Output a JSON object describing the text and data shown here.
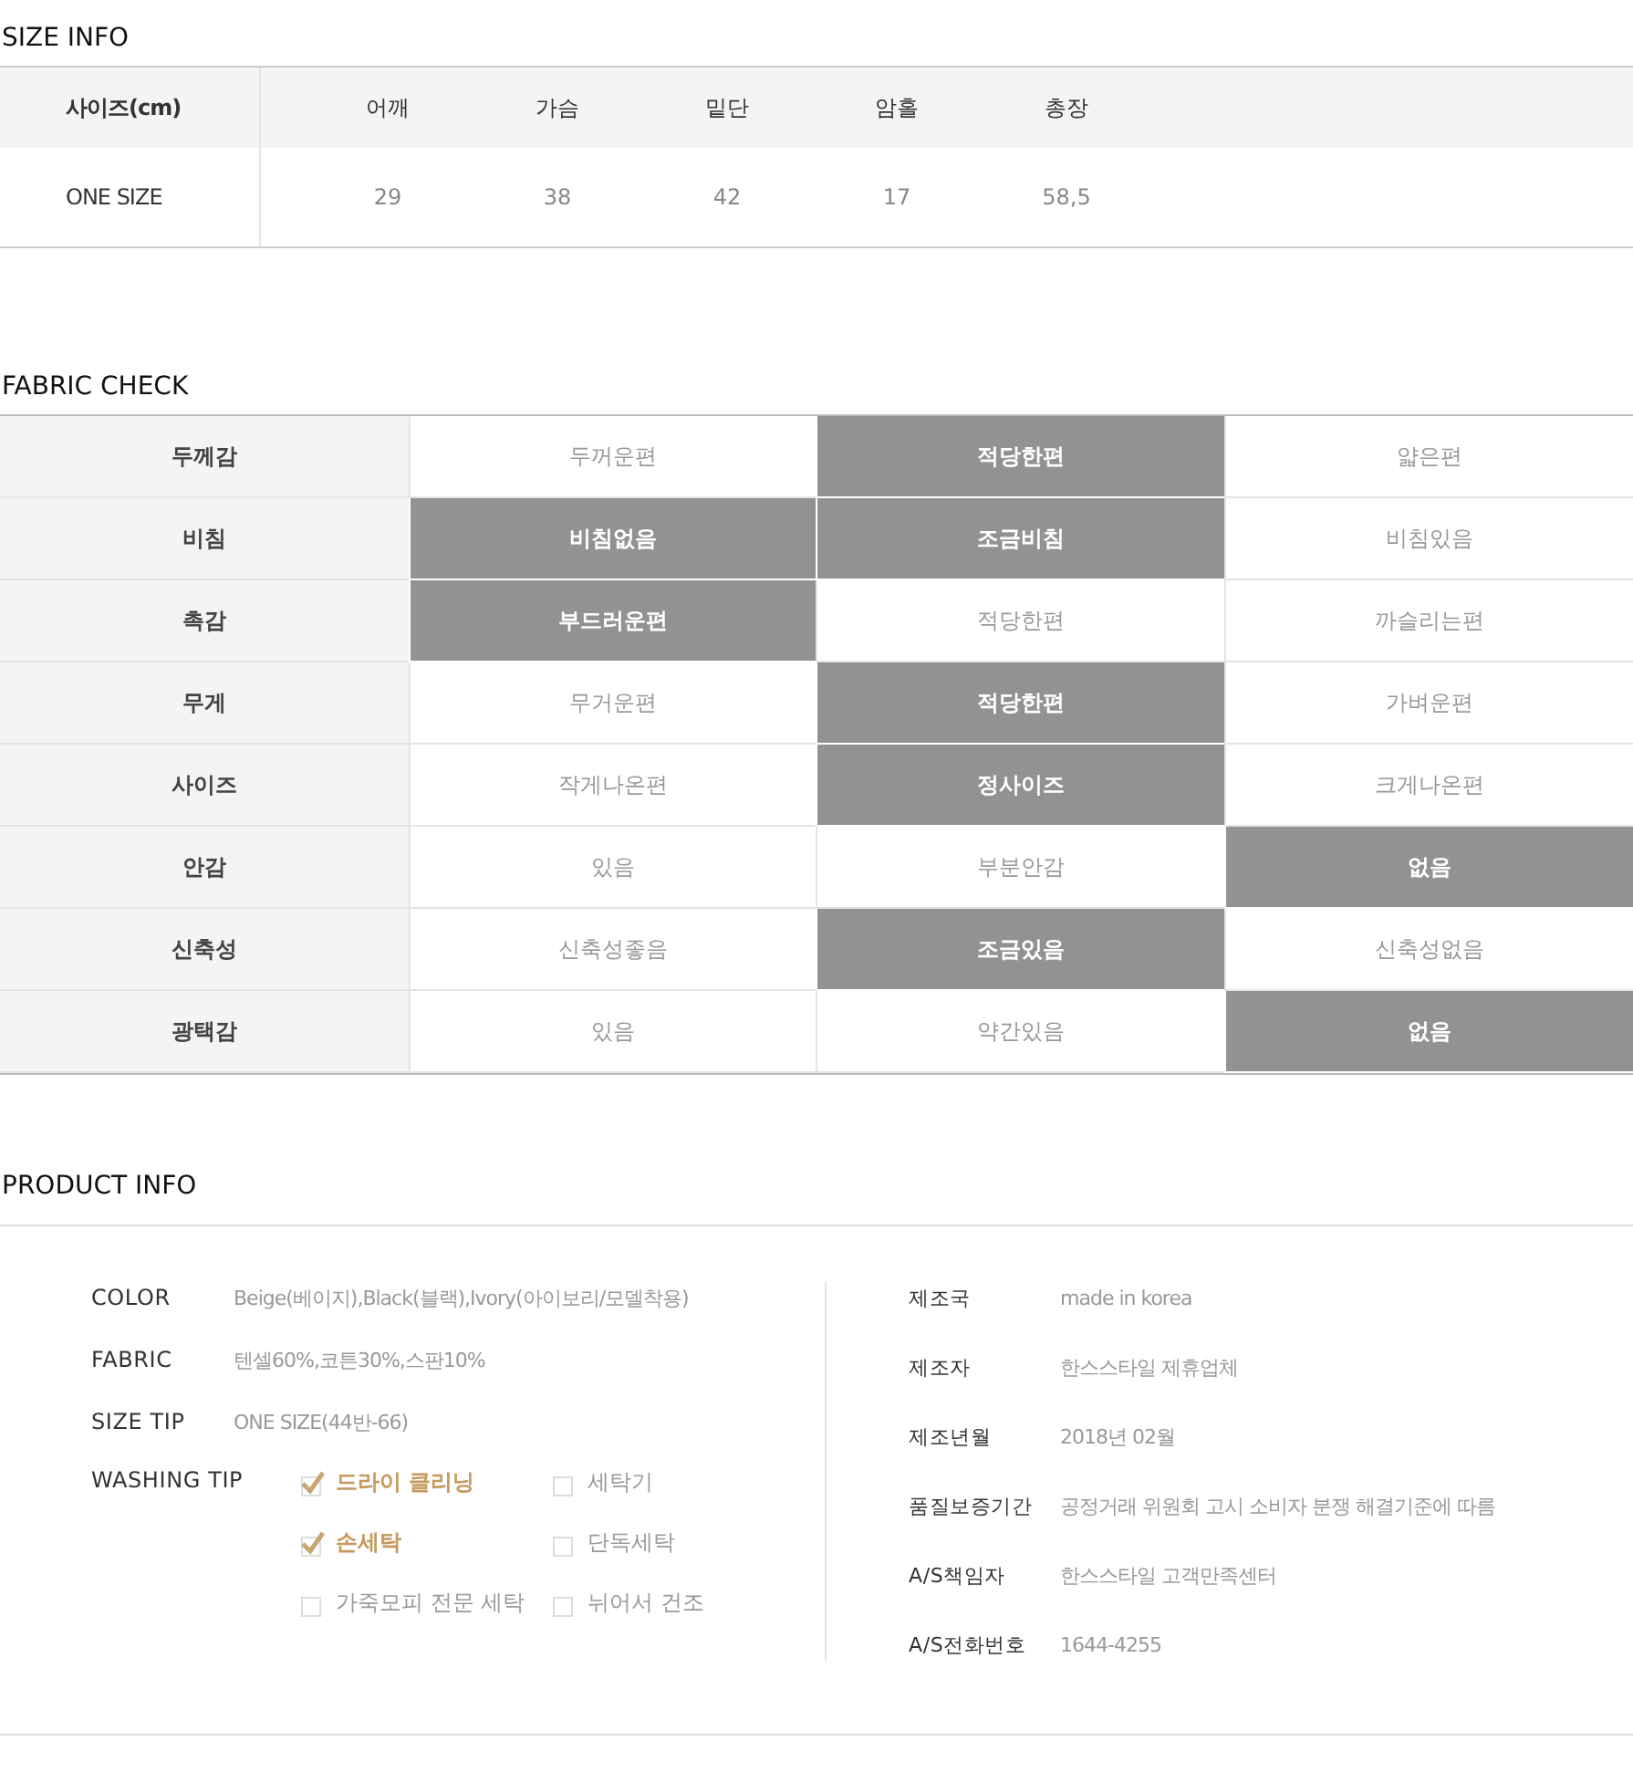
{
  "size_info": {
    "title": "SIZE INFO",
    "header": "사이즈(cm)",
    "columns": [
      "어깨",
      "가슴",
      "밑단",
      "암홀",
      "총장"
    ],
    "rows": [
      {
        "size": "ONE SIZE",
        "values": [
          "29",
          "38",
          "42",
          "17",
          "58,5"
        ]
      }
    ]
  },
  "fabric_check": {
    "title": "FABRIC CHECK",
    "rows": [
      {
        "label": "두께감",
        "options": [
          {
            "label": "두꺼운편",
            "selected": false
          },
          {
            "label": "적당한편",
            "selected": true
          },
          {
            "label": "얇은편",
            "selected": false
          }
        ]
      },
      {
        "label": "비침",
        "options": [
          {
            "label": "비침없음",
            "selected": true
          },
          {
            "label": "조금비침",
            "selected": true
          },
          {
            "label": "비침있음",
            "selected": false
          }
        ]
      },
      {
        "label": "촉감",
        "options": [
          {
            "label": "부드러운편",
            "selected": true
          },
          {
            "label": "적당한편",
            "selected": false
          },
          {
            "label": "까슬리는편",
            "selected": false
          }
        ]
      },
      {
        "label": "무게",
        "options": [
          {
            "label": "무거운편",
            "selected": false
          },
          {
            "label": "적당한편",
            "selected": true
          },
          {
            "label": "가벼운편",
            "selected": false
          }
        ]
      },
      {
        "label": "사이즈",
        "options": [
          {
            "label": "작게나온편",
            "selected": false
          },
          {
            "label": "정사이즈",
            "selected": true
          },
          {
            "label": "크게나온편",
            "selected": false
          }
        ]
      },
      {
        "label": "안감",
        "options": [
          {
            "label": "있음",
            "selected": false
          },
          {
            "label": "부분안감",
            "selected": false
          },
          {
            "label": "없음",
            "selected": true
          }
        ]
      },
      {
        "label": "신축성",
        "options": [
          {
            "label": "신축성좋음",
            "selected": false
          },
          {
            "label": "조금있음",
            "selected": true
          },
          {
            "label": "신축성없음",
            "selected": false
          }
        ]
      },
      {
        "label": "광택감",
        "options": [
          {
            "label": "있음",
            "selected": false
          },
          {
            "label": "약간있음",
            "selected": false
          },
          {
            "label": "없음",
            "selected": true
          }
        ]
      }
    ]
  },
  "product_info": {
    "title": "PRODUCT INFO",
    "details": [
      {
        "label": "COLOR",
        "value": "Beige(베이지),Black(블랙),Ivory(아이보리/모델착용)"
      },
      {
        "label": "FABRIC",
        "value": "텐셀60%,코튼30%,스판10%"
      },
      {
        "label": "SIZE TIP",
        "value": "ONE SIZE(44반-66)"
      }
    ],
    "washing_tip": {
      "label": "WASHING TIP",
      "items": [
        {
          "label": "드라이 클리닝",
          "checked": true
        },
        {
          "label": "세탁기",
          "checked": false
        },
        {
          "label": "손세탁",
          "checked": true
        },
        {
          "label": "단독세탁",
          "checked": false
        },
        {
          "label": "가죽모피 전문 세탁",
          "checked": false
        },
        {
          "label": "뉘어서 건조",
          "checked": false
        }
      ]
    },
    "notices": [
      {
        "label": "제조국",
        "value": "made in korea"
      },
      {
        "label": "제조자",
        "value": "한스스타일 제휴업체"
      },
      {
        "label": "제조년월",
        "value": "2018년 02월"
      },
      {
        "label": "품질보증기간",
        "value": "공정거래 위원회 고시 소비자 분쟁 해결기준에 따름"
      },
      {
        "label": "A/S책임자",
        "value": "한스스타일 고객만족센터"
      },
      {
        "label": "A/S전화번호",
        "value": "1644-4255"
      }
    ]
  }
}
